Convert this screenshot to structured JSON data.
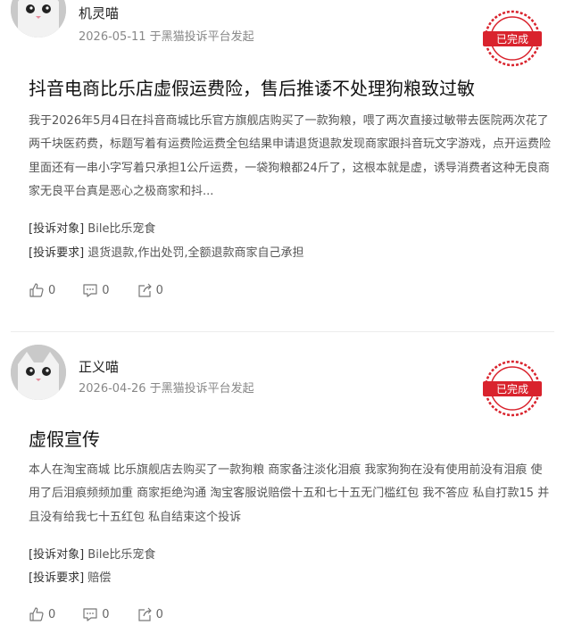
{
  "posts": [
    {
      "user": "机灵喵",
      "meta": "2026-05-11 于黑猫投诉平台发起",
      "stamp": "已完成",
      "title": "抖音电商比乐店虚假运费险，售后推诿不处理狗粮致过敏",
      "body": "我于2026年5月4日在抖音商城比乐官方旗舰店购买了一款狗粮，喂了两次直接过敏带去医院两次花了两千块医药费，标题写着有运费险运费全包结果申请退货退款发现商家跟抖音玩文字游戏，点开运费险里面还有一串小字写着只承担1公斤运费，一袋狗粮都24斤了，这根本就是虚，诱导消费者这种无良商家无良平台真是恶心之极商家和抖...",
      "target_label": "[投诉对象]",
      "target_value": "Bile比乐宠食",
      "request_label": "[投诉要求]",
      "request_value": "退货退款,作出处罚,全额退款商家自己承担",
      "likes": "0",
      "comments": "0",
      "shares": "0"
    },
    {
      "user": "正义喵",
      "meta": "2026-04-26 于黑猫投诉平台发起",
      "stamp": "已完成",
      "title": "虚假宣传",
      "body": "本人在淘宝商城 比乐旗舰店去购买了一款狗粮 商家备注淡化泪痕 我家狗狗在没有使用前没有泪痕 使用了后泪痕频频加重 商家拒绝沟通 淘宝客服说赔偿十五和七十五无门槛红包 我不答应 私自打款15 并且没有给我七十五红包 私自结束这个投诉",
      "target_label": "[投诉对象]",
      "target_value": "Bile比乐宠食",
      "request_label": "[投诉要求]",
      "request_value": "赔偿",
      "likes": "0",
      "comments": "0",
      "shares": "0"
    }
  ],
  "colors": {
    "stamp_red": "#d9232d",
    "muted": "#888888"
  },
  "icons": {
    "like": "thumbs-up-icon",
    "comment": "comment-icon",
    "share": "share-icon"
  }
}
